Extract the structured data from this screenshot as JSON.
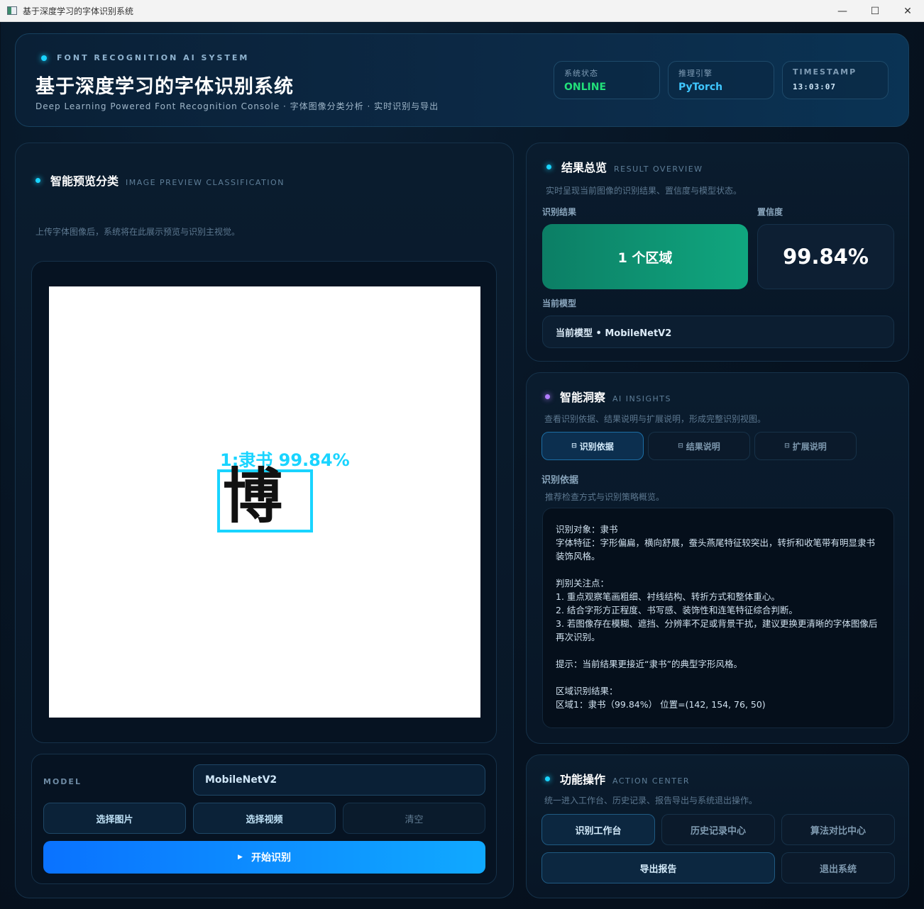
{
  "window": {
    "title": "基于深度学习的字体识别系统",
    "minimize": "—",
    "maximize": "☐",
    "close": "✕"
  },
  "header": {
    "eyebrow": "FONT RECOGNITION AI SYSTEM",
    "title": "基于深度学习的字体识别系统",
    "subtitle": "Deep Learning Powered Font Recognition Console · 字体图像分类分析 · 实时识别与导出",
    "stats": [
      {
        "label": "系统状态",
        "value": "ONLINE",
        "color": "#22e07a"
      },
      {
        "label": "推理引擎",
        "value": "PyTorch",
        "color": "#3fc7ff"
      },
      {
        "label": "TIMESTAMP",
        "value": "13:03:07",
        "color": "#cfe6f7"
      }
    ]
  },
  "preview": {
    "title": "智能预览分类",
    "title_en": "IMAGE PREVIEW CLASSIFICATION",
    "desc": "上传字体图像后，系统将在此展示预览与识别主视觉。",
    "detection_label": "1:隶书 99.84%",
    "glyph": "博"
  },
  "controls": {
    "model_label": "MODEL",
    "model_value": "MobileNetV2",
    "select_image": "选择图片",
    "select_video": "选择视频",
    "clear": "清空",
    "start": "开始识别",
    "start_icon": "▶"
  },
  "results": {
    "title": "结果总览",
    "title_en": "RESULT OVERVIEW",
    "desc": "实时呈现当前图像的识别结果、置信度与模型状态。",
    "result_label": "识别结果",
    "result_value": "1 个区域",
    "confidence_label": "置信度",
    "confidence_value": "99.84%",
    "model_label": "当前模型",
    "model_value": "当前模型 • MobileNetV2"
  },
  "insights": {
    "title": "智能洞察",
    "title_en": "AI INSIGHTS",
    "desc": "查看识别依据、结果说明与扩展说明，形成完整识别视图。",
    "tab_icon": "⊟",
    "tabs": [
      "识别依据",
      "结果说明",
      "扩展说明"
    ],
    "section_title": "识别依据",
    "section_desc": "推荐检查方式与识别策略概览。",
    "body": "识别对象：隶书\n字体特征：字形偏扁，横向舒展，蚕头燕尾特征较突出，转折和收笔带有明显隶书装饰风格。\n\n判别关注点：\n1. 重点观察笔画粗细、衬线结构、转折方式和整体重心。\n2. 结合字形方正程度、书写感、装饰性和连笔特征综合判断。\n3. 若图像存在模糊、遮挡、分辨率不足或背景干扰，建议更换更清晰的字体图像后再次识别。\n\n提示：当前结果更接近“隶书”的典型字形风格。\n\n区域识别结果：\n区域1：隶书（99.84%） 位置=(142, 154, 76, 50)"
  },
  "actions": {
    "title": "功能操作",
    "title_en": "ACTION CENTER",
    "desc": "统一进入工作台、历史记录、报告导出与系统退出操作。",
    "workbench": "识别工作台",
    "history": "历史记录中心",
    "compare": "算法对比中心",
    "export": "导出报告",
    "exit": "退出系统"
  }
}
